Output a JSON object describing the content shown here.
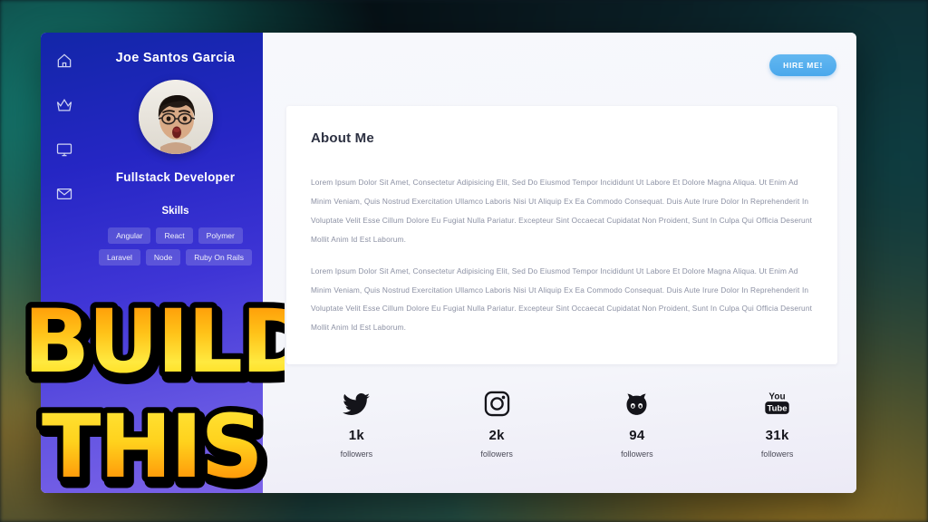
{
  "sidebar": {
    "name": "Joe Santos Garcia",
    "role": "Fullstack Developer",
    "skills_title": "Skills",
    "nav": [
      {
        "icon": "home-icon",
        "label": "Home"
      },
      {
        "icon": "crown-icon",
        "label": "Premium"
      },
      {
        "icon": "monitor-icon",
        "label": "Portfolio"
      },
      {
        "icon": "mail-icon",
        "label": "Contact"
      }
    ],
    "skills_row1": [
      "Angular",
      "React",
      "Polymer"
    ],
    "skills_row2": [
      "Laravel",
      "Node",
      "Ruby On Rails"
    ],
    "avatar_alt": "Joe Santos Garcia profile photo"
  },
  "main": {
    "hire_label": "HIRE ME!",
    "about_title": "About Me",
    "paragraph_1": "Lorem Ipsum Dolor Sit Amet, Consectetur Adipisicing Elit, Sed Do Eiusmod Tempor Incididunt Ut Labore Et Dolore Magna Aliqua. Ut Enim Ad Minim Veniam, Quis Nostrud Exercitation Ullamco Laboris Nisi Ut Aliquip Ex Ea Commodo Consequat. Duis Aute Irure Dolor In Reprehenderit In Voluptate Velit Esse Cillum Dolore Eu Fugiat Nulla Pariatur. Excepteur Sint Occaecat Cupidatat Non Proident, Sunt In Culpa Qui Officia Deserunt Mollit Anim Id Est Laborum.",
    "paragraph_2": "Lorem Ipsum Dolor Sit Amet, Consectetur Adipisicing Elit, Sed Do Eiusmod Tempor Incididunt Ut Labore Et Dolore Magna Aliqua. Ut Enim Ad Minim Veniam, Quis Nostrud Exercitation Ullamco Laboris Nisi Ut Aliquip Ex Ea Commodo Consequat. Duis Aute Irure Dolor In Reprehenderit In Voluptate Velit Esse Cillum Dolore Eu Fugiat Nulla Pariatur. Excepteur Sint Occaecat Cupidatat Non Proident, Sunt In Culpa Qui Officia Deserunt Mollit Anim Id Est Laborum."
  },
  "socials": [
    {
      "icon": "twitter-icon",
      "count": "1k",
      "label": "followers"
    },
    {
      "icon": "instagram-icon",
      "count": "2k",
      "label": "followers"
    },
    {
      "icon": "github-icon",
      "count": "94",
      "label": "followers"
    },
    {
      "icon": "youtube-icon",
      "count": "31k",
      "label": "followers"
    }
  ],
  "overlay": {
    "line1": "BUILD",
    "line2": "THIS"
  },
  "colors": {
    "sidebar_start": "#1226a8",
    "sidebar_end": "#7c63e8",
    "hire_button": "#4aa8ec",
    "card_background": "#ffffff",
    "main_background": "#f4f5fa",
    "heading_text": "#2d3142",
    "body_text": "#8b90a3",
    "overlay_yellow": "#ffd52e",
    "overlay_orange": "#f58220"
  }
}
